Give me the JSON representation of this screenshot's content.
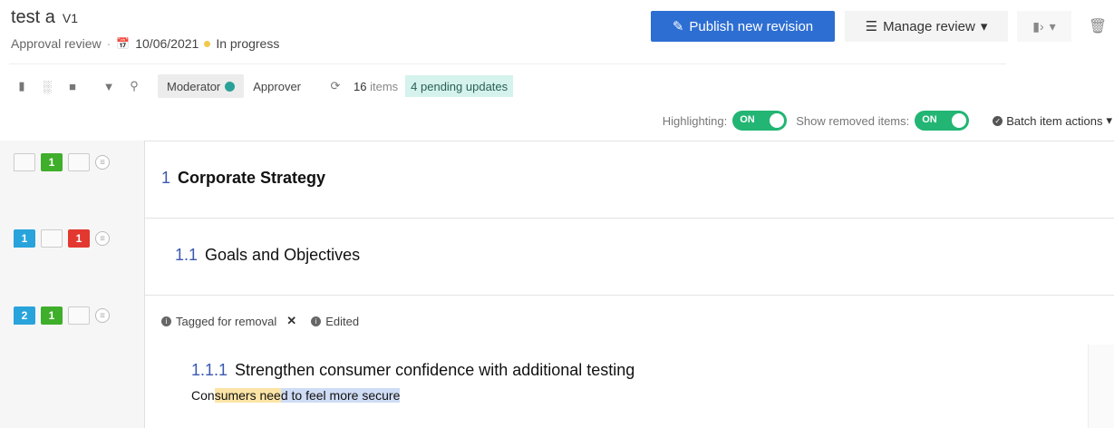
{
  "header": {
    "title": "test a",
    "version": "V1",
    "review_type": "Approval review",
    "date": "10/06/2021",
    "status": "In progress",
    "publish_label": "Publish new revision",
    "manage_label": "Manage review"
  },
  "toolbar": {
    "roles": [
      "Moderator",
      "Approver"
    ],
    "items_count": "16",
    "items_label": "items",
    "pending_label": "4 pending updates"
  },
  "options": {
    "highlighting_label": "Highlighting:",
    "highlighting_state": "ON",
    "show_removed_label": "Show removed items:",
    "show_removed_state": "ON",
    "batch_label": "Batch item actions"
  },
  "rows": [
    {
      "badges": [
        "",
        "1",
        "",
        ""
      ],
      "number": "1",
      "title": "Corporate Strategy"
    },
    {
      "badges": [
        "1",
        "",
        "1",
        ""
      ],
      "number": "1.1",
      "title": "Goals and Objectives"
    },
    {
      "badges": [
        "2",
        "1",
        "",
        ""
      ],
      "number": "1.1.1",
      "title": "Strengthen consumer confidence with additional testing",
      "tags": [
        "Tagged for removal",
        "Edited"
      ],
      "body": {
        "part1": "Con",
        "part2": "sumers nee",
        "part3": "d to feel more secure"
      }
    }
  ],
  "colors": {
    "accent": "#2d6ed2",
    "green": "#3fae2a",
    "red": "#e2382f",
    "blue": "#29a3dc",
    "pending_bg": "#d5f2ed",
    "toggle": "#22b573"
  }
}
